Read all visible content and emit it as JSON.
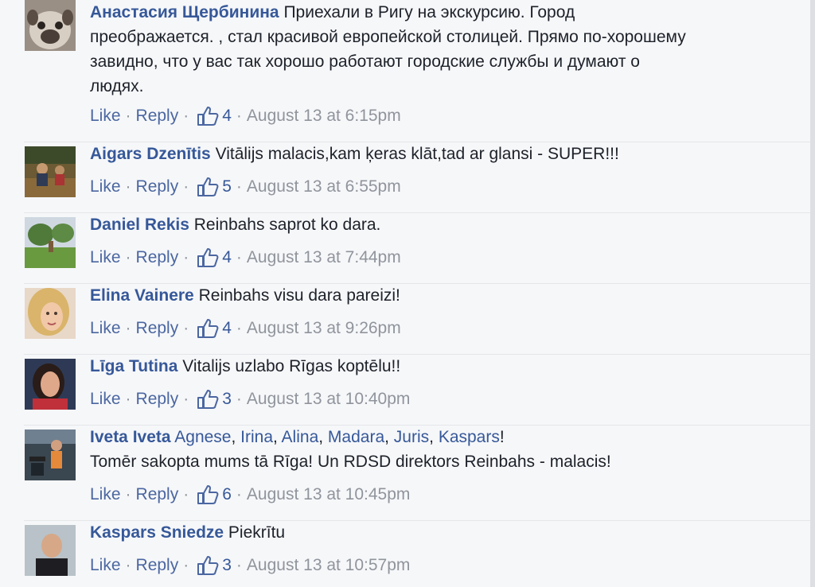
{
  "comments": [
    {
      "author": "Анастасия Щербинина",
      "text": "Приехали в Ригу на экскурсию. Город\nпреображается. , стал красивой европейской столицей. Прямо по-хорошему\nзавидно, что у вас так хорошо работают городские службы и думают о\nлюдях.",
      "like_label": "Like",
      "reply_label": "Reply",
      "likes": "4",
      "time": "August 13 at 6:15pm",
      "avatar": "pug-avatar"
    },
    {
      "author": "Aigars Dzenītis",
      "text": "Vitālijs malacis,kam ķeras klāt,tad ar glansi - SUPER!!!",
      "like_label": "Like",
      "reply_label": "Reply",
      "likes": "5",
      "time": "August 13 at 6:55pm",
      "avatar": "outdoor-group-avatar"
    },
    {
      "author": "Daniel Rekis",
      "text": "Reinbahs saprot ko dara.",
      "like_label": "Like",
      "reply_label": "Reply",
      "likes": "4",
      "time": "August 13 at 7:44pm",
      "avatar": "garden-avatar"
    },
    {
      "author": "Elina Vainere",
      "text": "Reinbahs visu dara pareizi!",
      "like_label": "Like",
      "reply_label": "Reply",
      "likes": "4",
      "time": "August 13 at 9:26pm",
      "avatar": "blonde-woman-avatar"
    },
    {
      "author": "Līga Tutina",
      "text": "Vitalijs uzlabo Rīgas koptēlu!!",
      "like_label": "Like",
      "reply_label": "Reply",
      "likes": "3",
      "time": "August 13 at 10:40pm",
      "avatar": "dark-hair-woman-avatar"
    },
    {
      "author": "Iveta Iveta",
      "mentions": [
        "Agnese",
        "Irina",
        "Alina",
        "Madara",
        "Juris",
        "Kaspars"
      ],
      "mention_sep": ", ",
      "mention_end": "!",
      "text2": "Tomēr sakopta mums tā Rīga! Un RDSD direktors Reinbahs - malacis!",
      "like_label": "Like",
      "reply_label": "Reply",
      "likes": "6",
      "time": "August 13 at 10:45pm",
      "avatar": "gym-avatar"
    },
    {
      "author": "Kaspars Sniedze",
      "text": "Piekrītu",
      "like_label": "Like",
      "reply_label": "Reply",
      "likes": "3",
      "time": "August 13 at 10:57pm",
      "avatar": "man-avatar"
    }
  ],
  "action_separator": "·",
  "colors": {
    "link": "#365899",
    "muted": "#90949c",
    "background": "#f6f7f9"
  }
}
